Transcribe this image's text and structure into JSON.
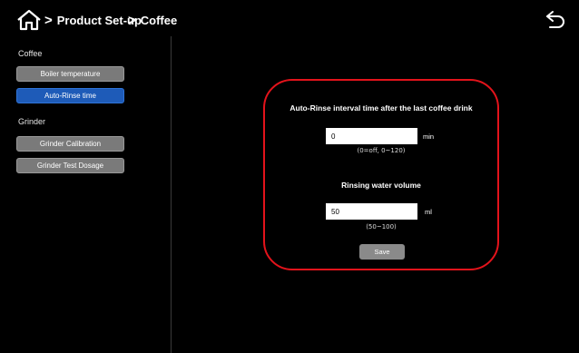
{
  "header": {
    "crumb1": "Product Set-up",
    "crumb2": "Coffee",
    "home_icon": "home-icon",
    "back_icon": "back-arrow-icon"
  },
  "sidebar": {
    "coffee_title": "Coffee",
    "coffee_items": [
      "Boiler temperature",
      "Auto-Rinse time"
    ],
    "grinder_title": "Grinder",
    "grinder_items": [
      "Grinder Calibration",
      "Grinder Test Dosage"
    ],
    "active_item": "Auto-Rinse time"
  },
  "panel": {
    "interval_heading": "Auto-Rinse interval time after the last coffee drink",
    "interval_value": "0",
    "interval_unit": "min",
    "interval_range": "(0=off,  0~120)",
    "volume_heading": "Rinsing water volume",
    "volume_value": "50",
    "volume_unit": "ml",
    "volume_range": "(50~100)",
    "save_label": "Save"
  },
  "colors": {
    "background": "#000000",
    "active_button": "#1e5bb8",
    "inactive_button": "#7a7a7a",
    "panel_border": "#e3131b"
  }
}
